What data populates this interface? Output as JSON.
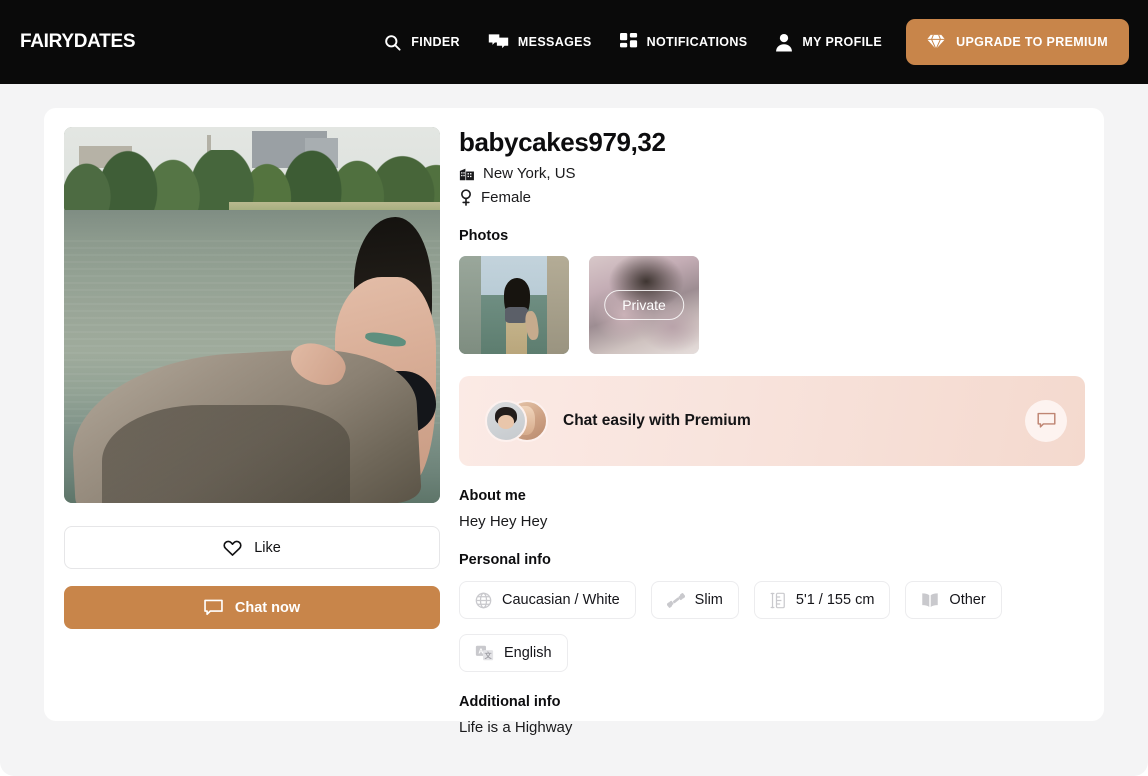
{
  "brand": "FAIRYDATES",
  "nav": [
    {
      "label": "FINDER",
      "icon": "search-icon"
    },
    {
      "label": "MESSAGES",
      "icon": "messages-icon"
    },
    {
      "label": "NOTIFICATIONS",
      "icon": "grid-icon"
    },
    {
      "label": "MY PROFILE",
      "icon": "person-icon"
    }
  ],
  "upgrade": {
    "label": "UPGRADE TO PREMIUM",
    "icon": "diamond-icon",
    "color": "#c8854a"
  },
  "profile": {
    "name": "babycakes979,32",
    "location": "New York, US",
    "location_icon": "city-icon",
    "gender": "Female",
    "gender_icon": "female-icon"
  },
  "actions": {
    "like_label": "Like",
    "like_icon": "heart-icon",
    "chat_label": "Chat now",
    "chat_icon": "chat-bubble-icon"
  },
  "photos": {
    "title": "Photos",
    "items": [
      {
        "name": "photo-beach",
        "private": false,
        "badge": ""
      },
      {
        "name": "photo-locked",
        "private": true,
        "badge": "Private"
      }
    ]
  },
  "banner": {
    "text": "Chat easily with Premium",
    "button_icon": "chat-bubble-icon",
    "bg_start": "#fbeae5",
    "bg_end": "#f4d9ce"
  },
  "about": {
    "title": "About me",
    "text": "Hey Hey Hey"
  },
  "personal": {
    "title": "Personal info",
    "chips": [
      {
        "label": "Caucasian / White",
        "icon": "globe-icon"
      },
      {
        "label": "Slim",
        "icon": "dumbbell-icon"
      },
      {
        "label": "5'1 / 155 cm",
        "icon": "ruler-icon"
      },
      {
        "label": "Other",
        "icon": "book-icon"
      },
      {
        "label": "English",
        "icon": "translate-icon"
      }
    ]
  },
  "additional": {
    "title": "Additional info",
    "text": "Life is a Highway"
  }
}
